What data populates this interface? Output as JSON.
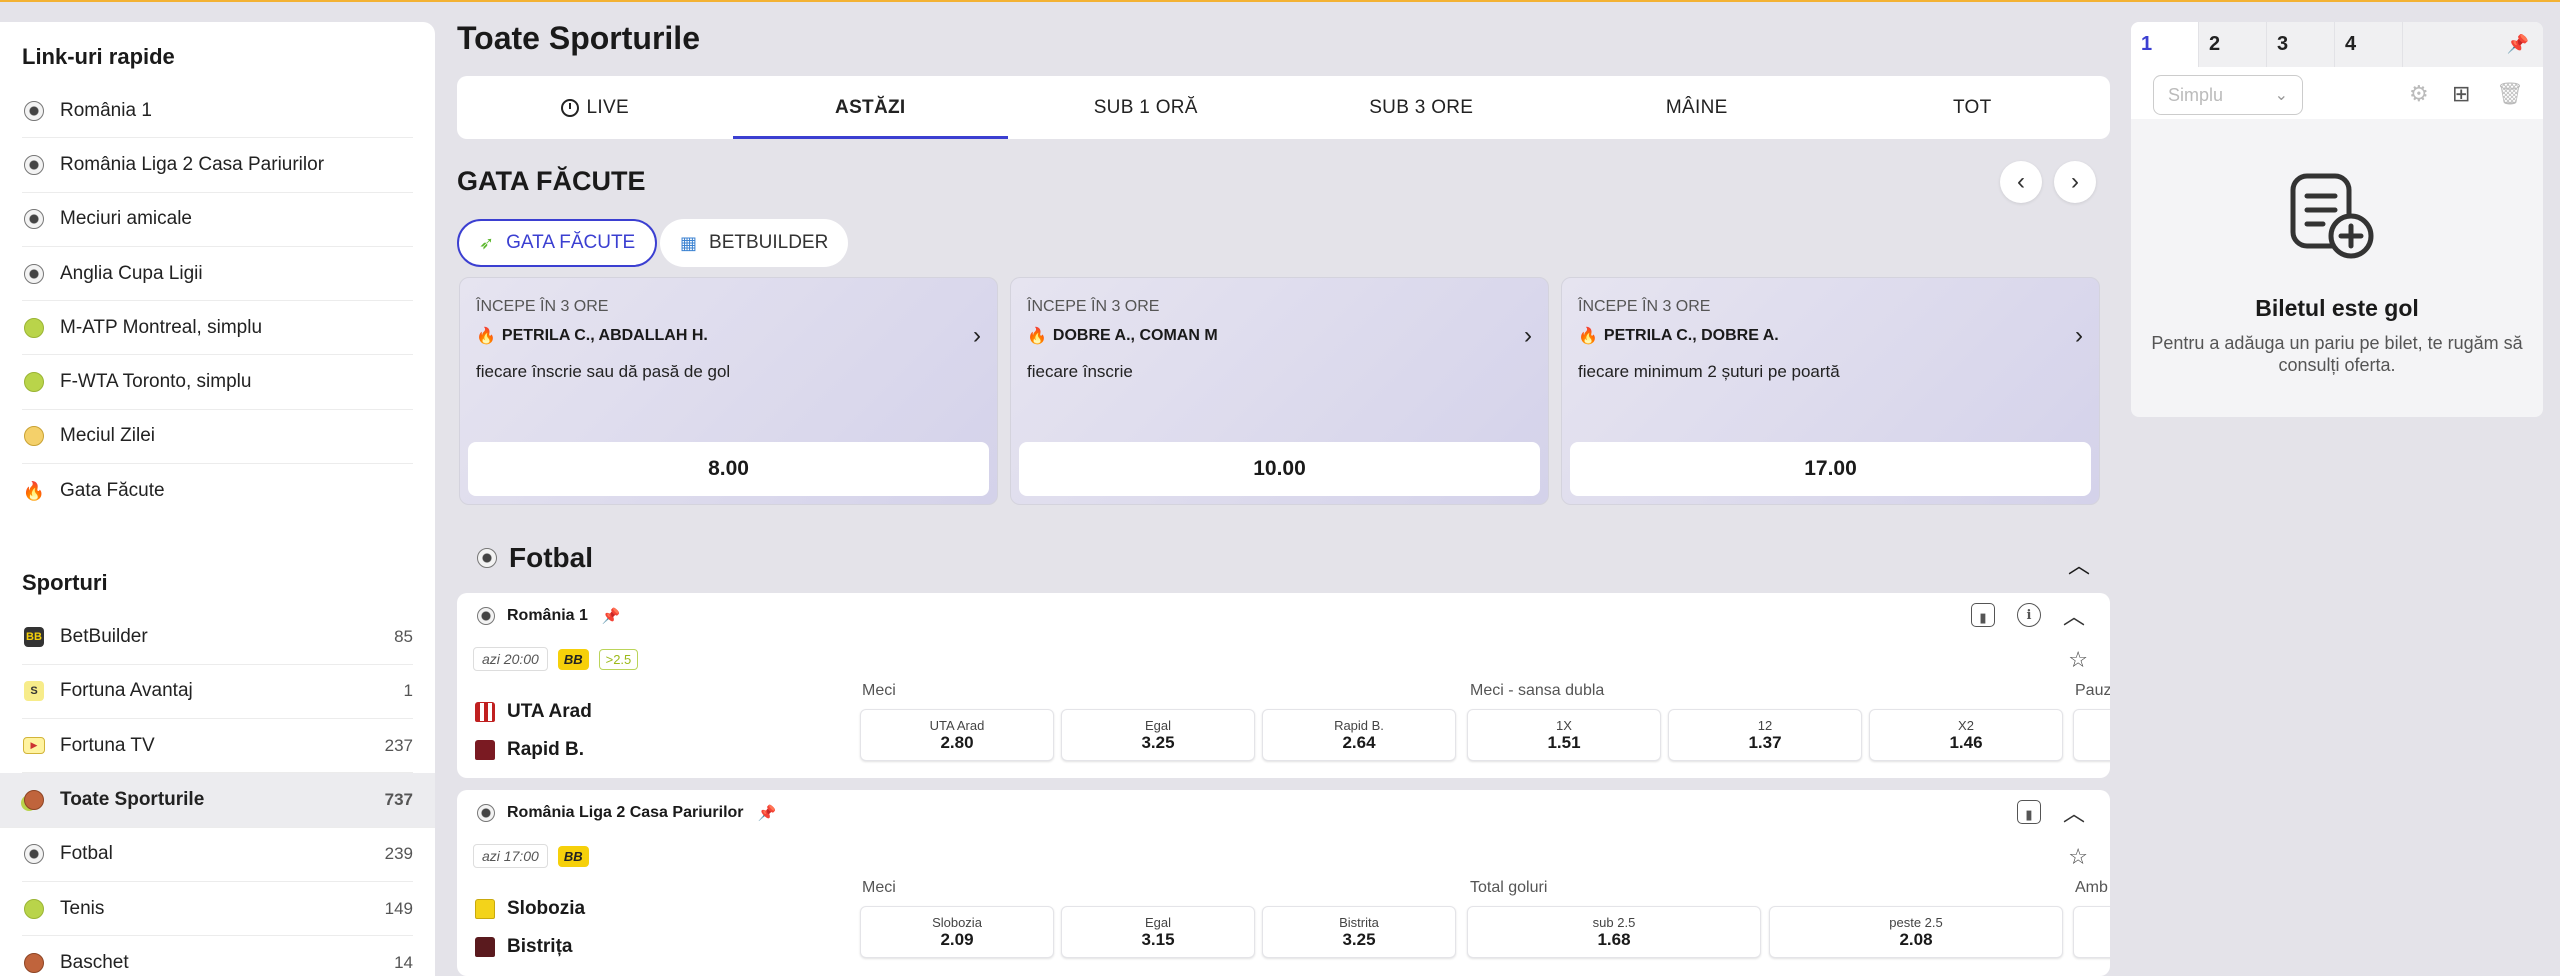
{
  "sidebar": {
    "quick_title": "Link-uri rapide",
    "quick_links": [
      {
        "label": "România 1",
        "icon": "soccer-ball-icon"
      },
      {
        "label": "România Liga 2 Casa Pariurilor",
        "icon": "soccer-ball-icon"
      },
      {
        "label": "Meciuri amicale",
        "icon": "soccer-ball-icon"
      },
      {
        "label": "Anglia Cupa Ligii",
        "icon": "soccer-ball-icon"
      },
      {
        "label": "M-ATP Montreal, simplu",
        "icon": "tennis-ball-icon"
      },
      {
        "label": "F-WTA Toronto, simplu",
        "icon": "tennis-ball-icon"
      },
      {
        "label": "Meciul Zilei",
        "icon": "star-badge-icon"
      },
      {
        "label": "Gata Făcute",
        "icon": "fire-icon"
      }
    ],
    "sports_title": "Sporturi",
    "sports": [
      {
        "label": "BetBuilder",
        "count": "85",
        "icon": "betbuilder-icon",
        "badge": "BB"
      },
      {
        "label": "Fortuna Avantaj",
        "count": "1",
        "icon": "avantaj-icon",
        "badge": "S"
      },
      {
        "label": "Fortuna TV",
        "count": "237",
        "icon": "tv-icon"
      },
      {
        "label": "Toate Sporturile",
        "count": "737",
        "icon": "all-sports-icon"
      },
      {
        "label": "Fotbal",
        "count": "239",
        "icon": "soccer-ball-icon"
      },
      {
        "label": "Tenis",
        "count": "149",
        "icon": "tennis-ball-icon"
      },
      {
        "label": "Baschet",
        "count": "14",
        "icon": "basketball-icon"
      }
    ]
  },
  "main": {
    "title": "Toate Sporturile",
    "tabs": [
      {
        "label": "LIVE"
      },
      {
        "label": "ASTĂZI"
      },
      {
        "label": "SUB 1 ORĂ"
      },
      {
        "label": "SUB 3 ORE"
      },
      {
        "label": "MÂINE"
      },
      {
        "label": "TOT"
      }
    ],
    "gata": {
      "title": "GATA FĂCUTE",
      "pills": [
        {
          "label": "GATA FĂCUTE"
        },
        {
          "label": "BETBUILDER"
        }
      ],
      "cards": [
        {
          "starts": "ÎNCEPE ÎN 3 ORE",
          "players": "PETRILA C., ABDALLAH H.",
          "desc": "fiecare înscrie sau dă pasă de gol",
          "odd": "8.00"
        },
        {
          "starts": "ÎNCEPE ÎN 3 ORE",
          "players": "DOBRE A., COMAN M",
          "desc": "fiecare înscrie",
          "odd": "10.00"
        },
        {
          "starts": "ÎNCEPE ÎN 3 ORE",
          "players": "PETRILA C., DOBRE A.",
          "desc": "fiecare minimum 2 șuturi pe poartă",
          "odd": "17.00"
        }
      ]
    },
    "sport_section": {
      "title": "Fotbal"
    },
    "leagues": [
      {
        "name": "România 1",
        "time": "azi 20:00",
        "bb": "BB",
        "plus": ">2.5",
        "home": "UTA Arad",
        "away": "Rapid B.",
        "market1": "Meci",
        "market2": "Meci - sansa dubla",
        "market3": "Pauz",
        "odds": [
          {
            "name": "UTA Arad",
            "value": "2.80"
          },
          {
            "name": "Egal",
            "value": "3.25"
          },
          {
            "name": "Rapid B.",
            "value": "2.64"
          },
          {
            "name": "1X",
            "value": "1.51"
          },
          {
            "name": "12",
            "value": "1.37"
          },
          {
            "name": "X2",
            "value": "1.46"
          }
        ]
      },
      {
        "name": "România Liga 2 Casa Pariurilor",
        "time": "azi 17:00",
        "bb": "BB",
        "home": "Slobozia",
        "away": "Bistrița",
        "market1": "Meci",
        "market2": "Total goluri",
        "market3": "Amb",
        "odds": [
          {
            "name": "Slobozia",
            "value": "2.09"
          },
          {
            "name": "Egal",
            "value": "3.15"
          },
          {
            "name": "Bistrita",
            "value": "3.25"
          },
          {
            "name": "sub 2.5",
            "value": "1.68"
          },
          {
            "name": "peste 2.5",
            "value": "2.08"
          }
        ]
      }
    ]
  },
  "betslip": {
    "tabs": [
      "1",
      "2",
      "3",
      "4"
    ],
    "type_select": "Simplu",
    "empty_title": "Biletul este gol",
    "empty_desc": "Pentru a adăuga un pariu pe bilet, te rugăm să consulți oferta."
  },
  "colors": {
    "accent": "#3b3fd1",
    "bb_badge": "#f6d00a",
    "top_line": "#f3b233"
  }
}
